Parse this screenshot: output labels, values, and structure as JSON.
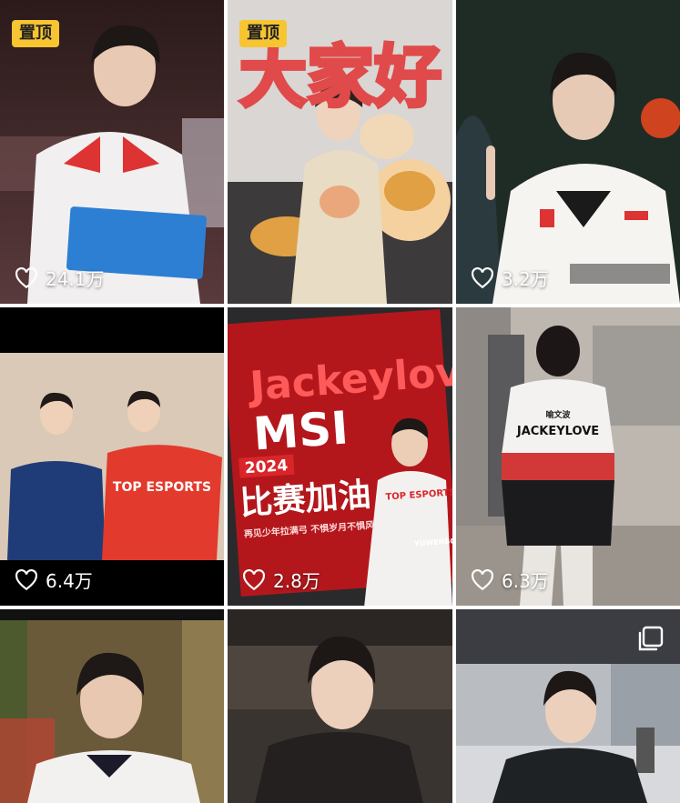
{
  "pin_label": "置顶",
  "tiles": [
    {
      "likes": "24.1万",
      "pinned": true
    },
    {
      "likes": "",
      "pinned": true,
      "headline": "大家好"
    },
    {
      "likes": "3.2万",
      "pinned": false
    },
    {
      "likes": "6.4万",
      "pinned": false,
      "shirt_text": "TOP ESPORTS"
    },
    {
      "likes": "2.8万",
      "pinned": false,
      "poster": {
        "name": "Jackeylove",
        "event": "MSI",
        "year": "2024",
        "slogan": "比赛加油",
        "sub": "再见少年拉满弓 不惧岁月不惧风",
        "team": "TOP ESPORTS",
        "tag": "YUWENBO"
      }
    },
    {
      "likes": "6.3万",
      "pinned": false,
      "back_text": "JACKEYLOVE",
      "back_name": "喻文波"
    },
    {
      "likes": "",
      "pinned": false
    },
    {
      "likes": "",
      "pinned": false
    },
    {
      "likes": "",
      "pinned": false,
      "multi_icon": "multi-image-icon"
    }
  ],
  "icons": {
    "like": "heart-outline-icon",
    "multi": "multi-image-icon"
  },
  "colors": {
    "pin_bg": "#f7c531",
    "jersey_red": "#e23a2c",
    "poster_red": "#d9262a"
  }
}
